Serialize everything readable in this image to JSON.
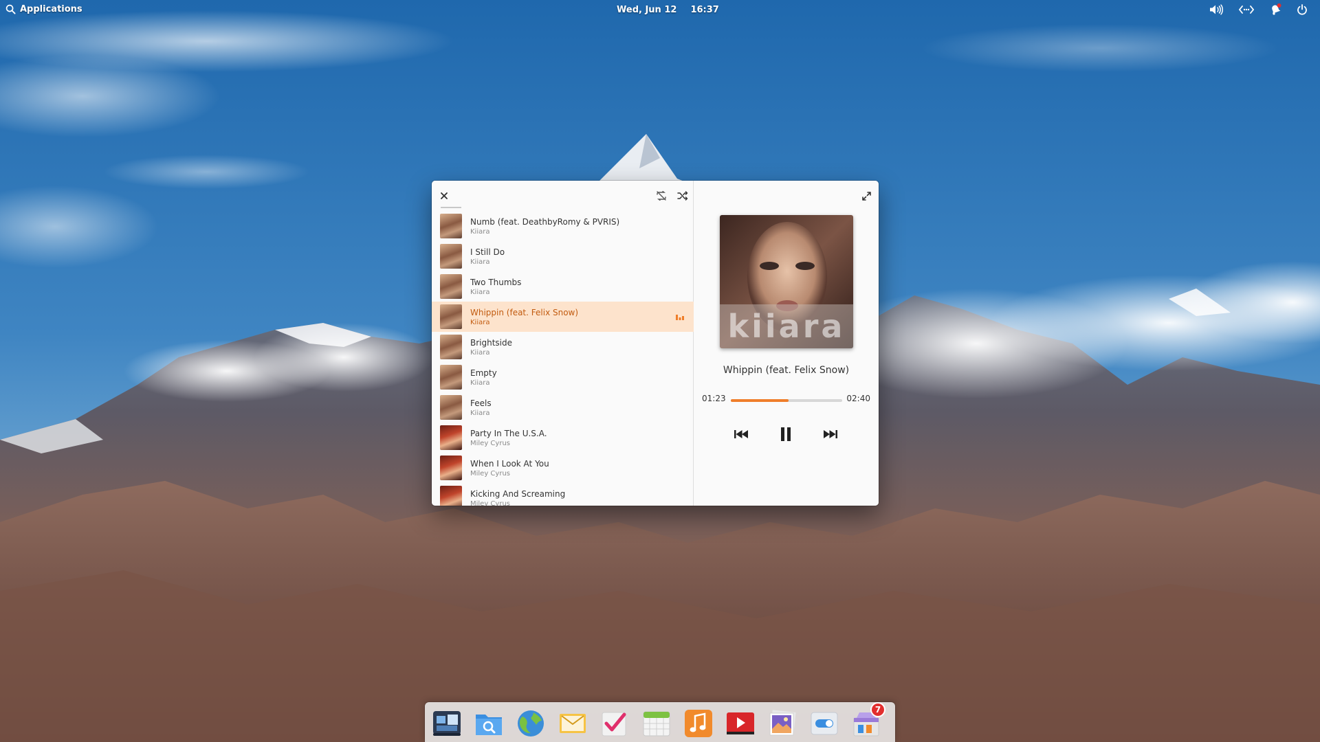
{
  "panel": {
    "applications_label": "Applications",
    "date": "Wed, Jun 12",
    "time": "16:37",
    "icons": [
      "search-icon",
      "volume-icon",
      "network-icon",
      "notifications-icon",
      "power-icon"
    ]
  },
  "window": {
    "icons": [
      "close-icon",
      "repeat-off-icon",
      "shuffle-icon",
      "fullscreen-icon"
    ],
    "playlist": [
      {
        "title": "Numb (feat. DeathbyRomy & PVRIS)",
        "artist": "Kiiara"
      },
      {
        "title": "I Still Do",
        "artist": "Kiiara"
      },
      {
        "title": "Two Thumbs",
        "artist": "Kiiara"
      },
      {
        "title": "Whippin (feat. Felix Snow)",
        "artist": "Kiiara"
      },
      {
        "title": "Brightside",
        "artist": "Kiiara"
      },
      {
        "title": "Empty",
        "artist": "Kiiara"
      },
      {
        "title": "Feels",
        "artist": "Kiiara"
      },
      {
        "title": "Party In The U.S.A.",
        "artist": "Miley Cyrus"
      },
      {
        "title": "When I Look At You",
        "artist": "Miley Cyrus"
      },
      {
        "title": "Kicking And Screaming",
        "artist": "Miley Cyrus"
      }
    ],
    "active_index": 3,
    "now_playing": {
      "title": "Whippin (feat. Felix Snow)",
      "current_time": "01:23",
      "duration": "02:40",
      "progress": 0.52,
      "album_art_text": "kiiara"
    },
    "colors": {
      "accent": "#ef7e2a",
      "active_row": "#fde3cc",
      "active_text": "#c25b0f"
    }
  },
  "dock": {
    "apps": [
      "multitasking-view",
      "files",
      "web-browser",
      "mail",
      "tasks",
      "calendar",
      "music",
      "videos",
      "photos",
      "system-settings",
      "appcenter"
    ],
    "appcenter_badge": "7"
  }
}
